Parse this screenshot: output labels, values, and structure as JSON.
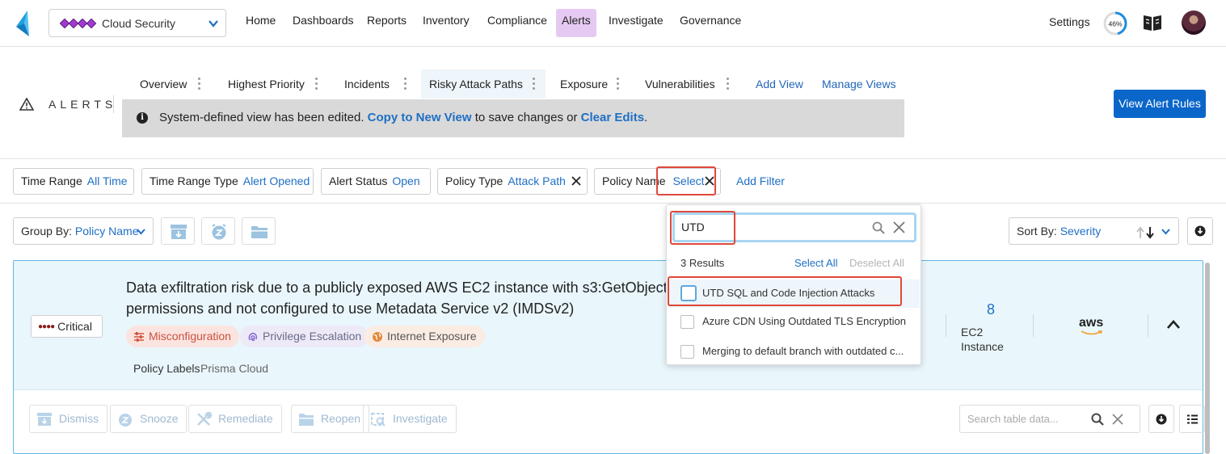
{
  "topnav": {
    "tenant": "Cloud Security",
    "items": [
      "Home",
      "Dashboards",
      "Reports",
      "Inventory",
      "Compliance",
      "Alerts",
      "Investigate",
      "Governance"
    ],
    "active": "Alerts",
    "settings": "Settings",
    "progress_label": "46%",
    "progress_value": 0.46,
    "icons": [
      "logo-icon",
      "chevron-down-icon",
      "book-icon",
      "avatar"
    ]
  },
  "header": {
    "section": "ALERTS",
    "tabs": [
      "Overview",
      "Highest Priority",
      "Incidents",
      "Risky Attack Paths",
      "Exposure",
      "Vulnerabilities"
    ],
    "active_tab": "Risky Attack Paths",
    "add_view": "Add View",
    "manage_views": "Manage Views",
    "banner": {
      "pre": "System-defined view has been edited.",
      "link1": "Copy to New View",
      "mid": "to save changes or",
      "link2": "Clear Edits",
      "post": "."
    },
    "primary_button": "View Alert Rules"
  },
  "filters": {
    "chips": [
      {
        "label": "Time Range",
        "value": "All Time"
      },
      {
        "label": "Time Range Type",
        "value": "Alert Opened"
      },
      {
        "label": "Alert Status",
        "value": "Open"
      },
      {
        "label": "Policy Type",
        "value": "Attack Path"
      },
      {
        "label": "Policy Name",
        "value": "Select"
      }
    ],
    "add_filter": "Add Filter"
  },
  "toolbar": {
    "group_by_label": "Group By:",
    "group_by_value": "Policy Name",
    "sort_by_label": "Sort By:",
    "sort_by_value": "Severity"
  },
  "dropdown": {
    "search_value": "UTD",
    "results": "3 Results",
    "select_all": "Select All",
    "deselect_all": "Deselect All",
    "options": [
      {
        "label": "UTD SQL and Code Injection Attacks",
        "checked": false
      },
      {
        "label": "Azure CDN Using Outdated TLS Encryption",
        "checked": false
      },
      {
        "label": "Merging to default branch with outdated c...",
        "checked": false
      }
    ]
  },
  "card": {
    "severity": "Critical",
    "title": "Data exfiltration risk due to a publicly exposed AWS EC2 instance with s3:GetObject a permissions and not configured to use Metadata Service v2 (IMDSv2)",
    "tags": [
      "Misconfiguration",
      "Privilege Escalation",
      "Internet Exposure"
    ],
    "policy_labels_label": "Policy Labels",
    "policy_labels_value": "Prisma Cloud",
    "asset_count": "8",
    "asset_type": "EC2 Instance",
    "cloud": "aws",
    "actions": [
      "Dismiss",
      "Snooze",
      "Remediate",
      "Reopen",
      "Investigate"
    ],
    "table_search_placeholder": "Search table data..."
  },
  "colors": {
    "accent": "#1f6fc4",
    "primary_button": "#0a66c9",
    "nav_active": "#e6c9f2",
    "highlight": "#e0483a",
    "critical": "#8a1a1a"
  }
}
